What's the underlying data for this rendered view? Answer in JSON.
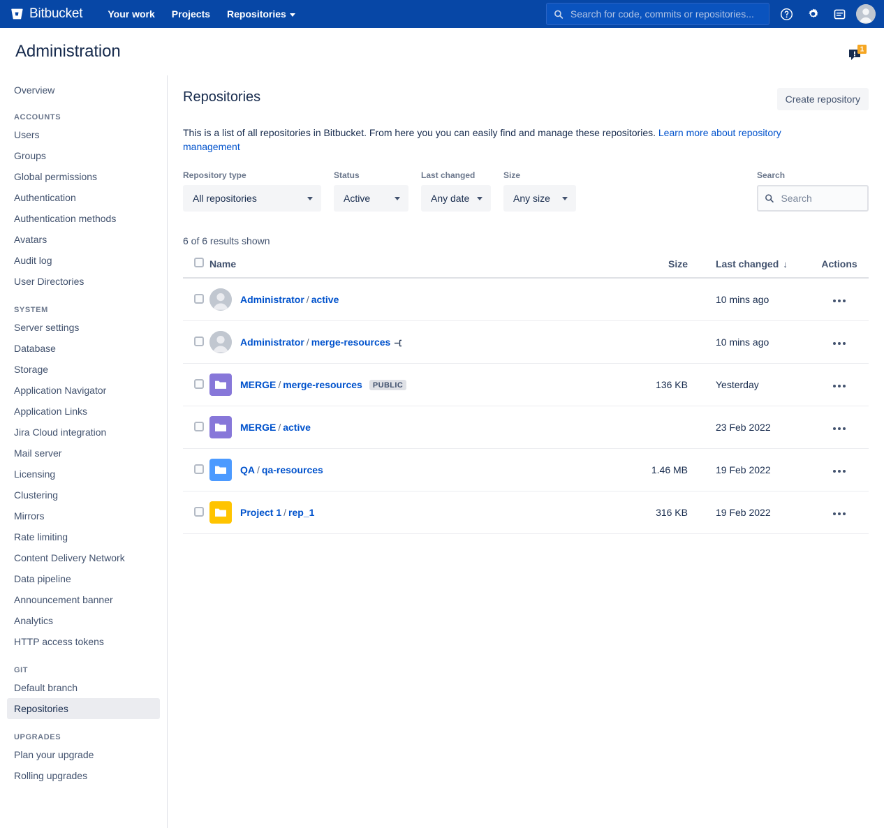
{
  "topnav": {
    "brand": "Bitbucket",
    "links": [
      {
        "label": "Your work",
        "has_chevron": false
      },
      {
        "label": "Projects",
        "has_chevron": false
      },
      {
        "label": "Repositories",
        "has_chevron": true
      }
    ],
    "search_placeholder": "Search for code, commits or repositories...",
    "search_value": "",
    "icons": [
      "help-icon",
      "settings-icon",
      "notifications-icon",
      "profile-avatar"
    ],
    "background_color": "#0747A6"
  },
  "page": {
    "title": "Administration",
    "feedback_badge_count": "1"
  },
  "sidebar": {
    "top_items": [
      {
        "label": "Overview",
        "selected": false
      }
    ],
    "sections": [
      {
        "heading": "ACCOUNTS",
        "items": [
          {
            "label": "Users",
            "selected": false
          },
          {
            "label": "Groups",
            "selected": false
          },
          {
            "label": "Global permissions",
            "selected": false
          },
          {
            "label": "Authentication",
            "selected": false
          },
          {
            "label": "Authentication methods",
            "selected": false
          },
          {
            "label": "Avatars",
            "selected": false
          },
          {
            "label": "Audit log",
            "selected": false
          },
          {
            "label": "User Directories",
            "selected": false
          }
        ]
      },
      {
        "heading": "SYSTEM",
        "items": [
          {
            "label": "Server settings",
            "selected": false
          },
          {
            "label": "Database",
            "selected": false
          },
          {
            "label": "Storage",
            "selected": false
          },
          {
            "label": "Application Navigator",
            "selected": false
          },
          {
            "label": "Application Links",
            "selected": false
          },
          {
            "label": "Jira Cloud integration",
            "selected": false
          },
          {
            "label": "Mail server",
            "selected": false
          },
          {
            "label": "Licensing",
            "selected": false
          },
          {
            "label": "Clustering",
            "selected": false
          },
          {
            "label": "Mirrors",
            "selected": false
          },
          {
            "label": "Rate limiting",
            "selected": false
          },
          {
            "label": "Content Delivery Network",
            "selected": false
          },
          {
            "label": "Data pipeline",
            "selected": false
          },
          {
            "label": "Announcement banner",
            "selected": false
          },
          {
            "label": "Analytics",
            "selected": false
          },
          {
            "label": "HTTP access tokens",
            "selected": false
          }
        ]
      },
      {
        "heading": "GIT",
        "items": [
          {
            "label": "Default branch",
            "selected": false
          },
          {
            "label": "Repositories",
            "selected": true
          }
        ]
      },
      {
        "heading": "UPGRADES",
        "items": [
          {
            "label": "Plan your upgrade",
            "selected": false
          },
          {
            "label": "Rolling upgrades",
            "selected": false
          }
        ]
      }
    ]
  },
  "main": {
    "section_title": "Repositories",
    "create_button": "Create repository",
    "intro_text": "This is a list of all repositories in Bitbucket. From here you you can easily find and manage these repositories. ",
    "intro_link": "Learn more about repository management",
    "filters": [
      {
        "label": "Repository type",
        "value": "All repositories",
        "name": "repository-type"
      },
      {
        "label": "Status",
        "value": "Active",
        "name": "status"
      },
      {
        "label": "Last changed",
        "value": "Any date",
        "name": "last-changed"
      },
      {
        "label": "Size",
        "value": "Any size",
        "name": "size"
      }
    ],
    "search": {
      "label": "Search",
      "placeholder": "Search",
      "value": ""
    },
    "results_count": "6 of 6 results shown",
    "columns": {
      "name": "Name",
      "size": "Size",
      "last_changed": "Last changed",
      "sort_indicator": "↓",
      "actions": "Actions"
    },
    "rows": [
      {
        "icon_type": "avatar",
        "icon_color": "#C1C7D0",
        "owner": "Administrator",
        "repo": "active",
        "badge": "",
        "fork": false,
        "size": "",
        "last_changed": "10 mins ago"
      },
      {
        "icon_type": "avatar",
        "icon_color": "#C1C7D0",
        "owner": "Administrator",
        "repo": "merge-resources",
        "badge": "",
        "fork": true,
        "size": "",
        "last_changed": "10 mins ago"
      },
      {
        "icon_type": "project",
        "icon_color": "#8777D9",
        "owner": "MERGE",
        "repo": "merge-resources",
        "badge": "PUBLIC",
        "fork": false,
        "size": "136 KB",
        "last_changed": "Yesterday"
      },
      {
        "icon_type": "project",
        "icon_color": "#8777D9",
        "owner": "MERGE",
        "repo": "active",
        "badge": "",
        "fork": false,
        "size": "",
        "last_changed": "23 Feb 2022"
      },
      {
        "icon_type": "project",
        "icon_color": "#4C9AFF",
        "owner": "QA",
        "repo": "qa-resources",
        "badge": "",
        "fork": false,
        "size": "1.46 MB",
        "last_changed": "19 Feb 2022"
      },
      {
        "icon_type": "project",
        "icon_color": "#FFC400",
        "owner": "Project 1",
        "repo": "rep_1",
        "badge": "",
        "fork": false,
        "size": "316 KB",
        "last_changed": "19 Feb 2022"
      }
    ]
  },
  "colors": {
    "brand_blue": "#0747A6",
    "link_blue": "#0052CC",
    "text_dark": "#172B4D",
    "text_subtle": "#6B778C"
  }
}
